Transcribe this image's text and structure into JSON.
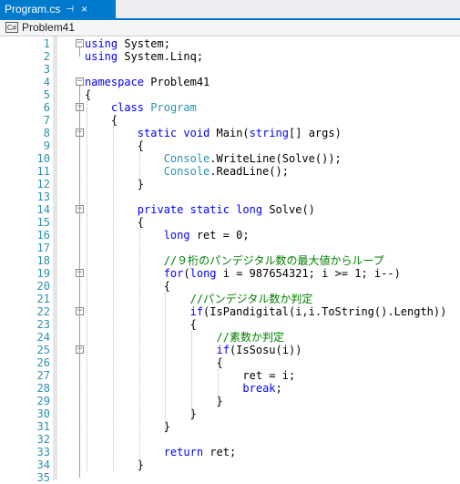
{
  "tab": {
    "title": "Program.cs",
    "pin_icon": "pin-icon",
    "close_glyph": "×"
  },
  "nav": {
    "project_icon": "C#",
    "project": "Problem41"
  },
  "lines": [
    {
      "n": "1",
      "fold": "−",
      "parts": [
        {
          "c": "kw",
          "t": "using"
        },
        {
          "c": "",
          "t": " System;"
        }
      ]
    },
    {
      "n": "2",
      "fold": "",
      "parts": [
        {
          "c": "kw",
          "t": "using"
        },
        {
          "c": "",
          "t": " System.Linq;"
        }
      ]
    },
    {
      "n": "3",
      "fold": "",
      "parts": []
    },
    {
      "n": "4",
      "fold": "−",
      "parts": [
        {
          "c": "kw",
          "t": "namespace"
        },
        {
          "c": "",
          "t": " Problem41"
        }
      ]
    },
    {
      "n": "5",
      "fold": "",
      "parts": [
        {
          "c": "",
          "t": "{"
        }
      ]
    },
    {
      "n": "6",
      "fold": "−",
      "parts": [
        {
          "c": "",
          "t": "    "
        },
        {
          "c": "kw",
          "t": "class"
        },
        {
          "c": "",
          "t": " "
        },
        {
          "c": "ty",
          "t": "Program"
        }
      ]
    },
    {
      "n": "7",
      "fold": "",
      "parts": [
        {
          "c": "",
          "t": "    {"
        }
      ]
    },
    {
      "n": "8",
      "fold": "−",
      "parts": [
        {
          "c": "",
          "t": "        "
        },
        {
          "c": "kw",
          "t": "static"
        },
        {
          "c": "",
          "t": " "
        },
        {
          "c": "kw",
          "t": "void"
        },
        {
          "c": "",
          "t": " Main("
        },
        {
          "c": "kw",
          "t": "string"
        },
        {
          "c": "",
          "t": "[] args)"
        }
      ]
    },
    {
      "n": "9",
      "fold": "",
      "parts": [
        {
          "c": "",
          "t": "        {"
        }
      ]
    },
    {
      "n": "10",
      "fold": "",
      "parts": [
        {
          "c": "",
          "t": "            "
        },
        {
          "c": "ty",
          "t": "Console"
        },
        {
          "c": "",
          "t": ".WriteLine(Solve());"
        }
      ]
    },
    {
      "n": "11",
      "fold": "",
      "parts": [
        {
          "c": "",
          "t": "            "
        },
        {
          "c": "ty",
          "t": "Console"
        },
        {
          "c": "",
          "t": ".ReadLine();"
        }
      ]
    },
    {
      "n": "12",
      "fold": "",
      "parts": [
        {
          "c": "",
          "t": "        }"
        }
      ]
    },
    {
      "n": "13",
      "fold": "",
      "parts": []
    },
    {
      "n": "14",
      "fold": "−",
      "parts": [
        {
          "c": "",
          "t": "        "
        },
        {
          "c": "kw",
          "t": "private"
        },
        {
          "c": "",
          "t": " "
        },
        {
          "c": "kw",
          "t": "static"
        },
        {
          "c": "",
          "t": " "
        },
        {
          "c": "kw",
          "t": "long"
        },
        {
          "c": "",
          "t": " Solve()"
        }
      ]
    },
    {
      "n": "15",
      "fold": "",
      "parts": [
        {
          "c": "",
          "t": "        {"
        }
      ]
    },
    {
      "n": "16",
      "fold": "",
      "parts": [
        {
          "c": "",
          "t": "            "
        },
        {
          "c": "kw",
          "t": "long"
        },
        {
          "c": "",
          "t": " ret = 0;"
        }
      ]
    },
    {
      "n": "17",
      "fold": "",
      "parts": []
    },
    {
      "n": "18",
      "fold": "",
      "parts": [
        {
          "c": "",
          "t": "            "
        },
        {
          "c": "cm",
          "t": "//９桁のパンデジタル数の最大値からループ"
        }
      ]
    },
    {
      "n": "19",
      "fold": "−",
      "parts": [
        {
          "c": "",
          "t": "            "
        },
        {
          "c": "kw",
          "t": "for"
        },
        {
          "c": "",
          "t": "("
        },
        {
          "c": "kw",
          "t": "long"
        },
        {
          "c": "",
          "t": " i = 987654321; i >= 1; i--)"
        }
      ]
    },
    {
      "n": "20",
      "fold": "",
      "parts": [
        {
          "c": "",
          "t": "            {"
        }
      ]
    },
    {
      "n": "21",
      "fold": "",
      "parts": [
        {
          "c": "",
          "t": "                "
        },
        {
          "c": "cm",
          "t": "//パンデジタル数か判定"
        }
      ]
    },
    {
      "n": "22",
      "fold": "−",
      "parts": [
        {
          "c": "",
          "t": "                "
        },
        {
          "c": "kw",
          "t": "if"
        },
        {
          "c": "",
          "t": "(IsPandigital(i,i.ToString().Length))"
        }
      ]
    },
    {
      "n": "23",
      "fold": "",
      "parts": [
        {
          "c": "",
          "t": "                {"
        }
      ]
    },
    {
      "n": "24",
      "fold": "",
      "parts": [
        {
          "c": "",
          "t": "                    "
        },
        {
          "c": "cm",
          "t": "//素数か判定"
        }
      ]
    },
    {
      "n": "25",
      "fold": "−",
      "parts": [
        {
          "c": "",
          "t": "                    "
        },
        {
          "c": "kw",
          "t": "if"
        },
        {
          "c": "",
          "t": "(IsSosu(i))"
        }
      ]
    },
    {
      "n": "26",
      "fold": "",
      "parts": [
        {
          "c": "",
          "t": "                    {"
        }
      ]
    },
    {
      "n": "27",
      "fold": "",
      "parts": [
        {
          "c": "",
          "t": "                        ret = i;"
        }
      ]
    },
    {
      "n": "28",
      "fold": "",
      "parts": [
        {
          "c": "",
          "t": "                        "
        },
        {
          "c": "kw",
          "t": "break"
        },
        {
          "c": "",
          "t": ";"
        }
      ]
    },
    {
      "n": "29",
      "fold": "",
      "parts": [
        {
          "c": "",
          "t": "                    }"
        }
      ]
    },
    {
      "n": "30",
      "fold": "",
      "parts": [
        {
          "c": "",
          "t": "                }"
        }
      ]
    },
    {
      "n": "31",
      "fold": "",
      "parts": [
        {
          "c": "",
          "t": "            }"
        }
      ]
    },
    {
      "n": "32",
      "fold": "",
      "parts": []
    },
    {
      "n": "33",
      "fold": "",
      "parts": [
        {
          "c": "",
          "t": "            "
        },
        {
          "c": "kw",
          "t": "return"
        },
        {
          "c": "",
          "t": " ret;"
        }
      ]
    },
    {
      "n": "34",
      "fold": "",
      "parts": [
        {
          "c": "",
          "t": "        }"
        }
      ]
    },
    {
      "n": "35",
      "fold": "",
      "parts": []
    }
  ]
}
